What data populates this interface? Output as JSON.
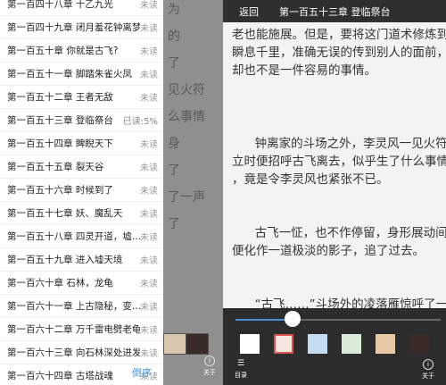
{
  "left_page_fragments": [
    "为",
    "的",
    "了",
    "见火符",
    "么事情",
    "身",
    "了",
    "了一声",
    "了"
  ],
  "toc": {
    "rows": [
      {
        "title": "第一百四十八章 十乙九光",
        "status": "未读"
      },
      {
        "title": "第一百四十九章 闭月羞花钟离梦",
        "status": "未读"
      },
      {
        "title": "第一百五十章 你就是古飞?",
        "status": "未读"
      },
      {
        "title": "第一百五十一章 脚踏朱雀火凤",
        "status": "未读"
      },
      {
        "title": "第一百五十二章 王者无敌",
        "status": "未读"
      },
      {
        "title": "第一百五十三章 登临祭台",
        "status": "已读:5%"
      },
      {
        "title": "第一百五十四章 睥睨天下",
        "status": "未读"
      },
      {
        "title": "第一百五十五章 裂天谷",
        "status": "未读"
      },
      {
        "title": "第一百五十六章 时候到了",
        "status": "未读"
      },
      {
        "title": "第一百五十七章 妖、魔乱天",
        "status": "未读"
      },
      {
        "title": "第一百五十八章 四灵开道，墟…",
        "status": "未读"
      },
      {
        "title": "第一百五十九章 进入墟天境",
        "status": "未读"
      },
      {
        "title": "第一百六十章 石林，龙龟",
        "status": "未读"
      },
      {
        "title": "第一百六十一章 上古隐秘，变…",
        "status": "未读"
      },
      {
        "title": "第一百六十二章 万千雷电劈老龟",
        "status": "未读"
      },
      {
        "title": "第一百六十三章 向石林深处进发",
        "status": "未读"
      },
      {
        "title": "第一百六十四章 古塔战魂",
        "status": "未读"
      }
    ],
    "reverse_label": "倒序"
  },
  "reader": {
    "back_label": "返回",
    "chapter_title": "第一百五十三章 登临祭台",
    "paragraphs": [
      [
        "老也能施展。但是，要将这门道术修炼到",
        "瞬息千里，准确无误的传到别人的面前，",
        "却也不是一件容易的事情。"
      ],
      [
        "钟离家的斗场之外，李灵风一见火符，",
        "立时便招呼古飞离去，似乎生了什么事情",
        "，竟是令李灵风也紧张不已。"
      ],
      [
        "古飞一怔，也不作停留，身形展动间，",
        "便化作一道极淡的影子，追了过去。"
      ],
      [
        "“古飞……”斗场外的凌落雁惊呼了一声，"
      ]
    ],
    "brightness_percent": 28,
    "selected_theme_index": 1,
    "toolbar": {
      "toc_label": "目录",
      "about_label": "关于"
    }
  },
  "theme_colors": [
    "#ffffff",
    "#f3e6e1",
    "#c5dcee",
    "#d9ecd9",
    "#e8c9a6",
    "#3a2a28"
  ],
  "left_swatch_colors": [
    "#d9c7b0",
    "#3a2a28"
  ],
  "accent_color": "#4a90d9"
}
